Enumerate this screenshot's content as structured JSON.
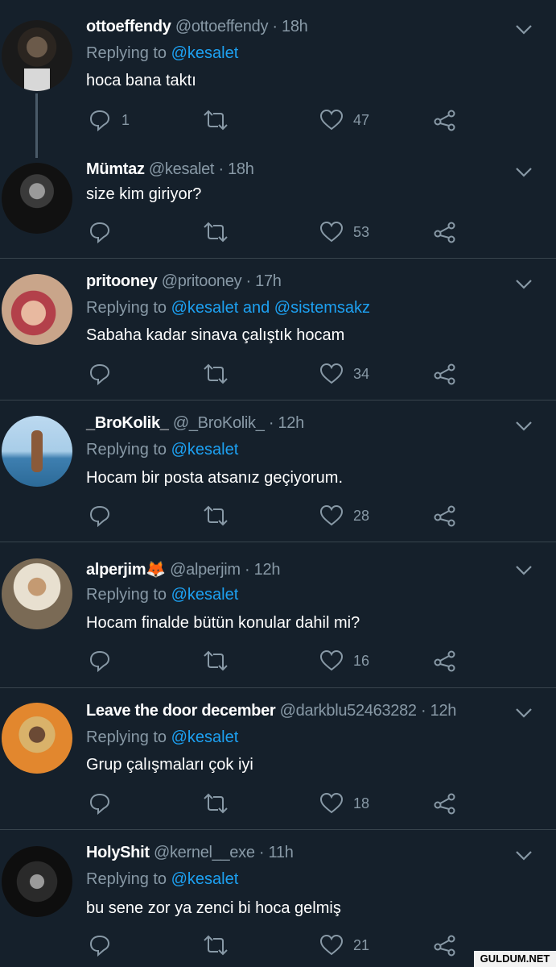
{
  "tweets": [
    {
      "name": "ottoeffendy",
      "handle": "@ottoeffendy",
      "sep": " · ",
      "time": "18h",
      "replying_prefix": "Replying to ",
      "replying_links": "@kesalet",
      "text": "hoca bana taktı",
      "reply_count": "1",
      "like_count": "47"
    },
    {
      "name": "Mümtaz",
      "handle": "@kesalet",
      "sep": " · ",
      "time": "18h",
      "text": "size kim giriyor?",
      "reply_count": "",
      "like_count": "53"
    },
    {
      "name": "pritooney",
      "handle": "@pritooney",
      "sep": " · ",
      "time": "17h",
      "replying_prefix": "Replying to ",
      "replying_links": "@kesalet and @sistemsakz",
      "text": "Sabaha kadar sinava çalıştık hocam",
      "reply_count": "",
      "like_count": "34"
    },
    {
      "name": "_BroKolik_",
      "handle": "@_BroKolik_",
      "sep": " · ",
      "time": "12h",
      "replying_prefix": "Replying to ",
      "replying_links": "@kesalet",
      "text": "Hocam bir posta atsanız geçiyorum.",
      "reply_count": "",
      "like_count": "28"
    },
    {
      "name": "alperjim🦊",
      "handle": "@alperjim",
      "sep": " · ",
      "time": "12h",
      "replying_prefix": "Replying to ",
      "replying_links": "@kesalet",
      "text": "Hocam finalde bütün konular dahil mi?",
      "reply_count": "",
      "like_count": "16"
    },
    {
      "name": "Leave the door december",
      "handle": "@darkblu52463282",
      "sep": " · ",
      "time": "12h",
      "replying_prefix": "Replying to ",
      "replying_links": "@kesalet",
      "text": "Grup çalışmaları çok iyi",
      "reply_count": "",
      "like_count": "18"
    },
    {
      "name": "HolyShit",
      "handle": "@kernel__exe",
      "sep": " · ",
      "time": "11h",
      "replying_prefix": "Replying to ",
      "replying_links": "@kesalet",
      "text": "bu sene zor ya zenci bi hoca gelmiş",
      "reply_count": "",
      "like_count": "21"
    }
  ],
  "icons": {
    "reply": "reply-icon",
    "retweet": "retweet-icon",
    "like": "heart-icon",
    "share": "share-icon",
    "menu": "chevron-down-icon"
  },
  "colors": {
    "background": "#15202b",
    "link": "#1da1f2",
    "muted": "#8899a6",
    "divider": "#38444d"
  },
  "watermark": "GULDUM.NET"
}
